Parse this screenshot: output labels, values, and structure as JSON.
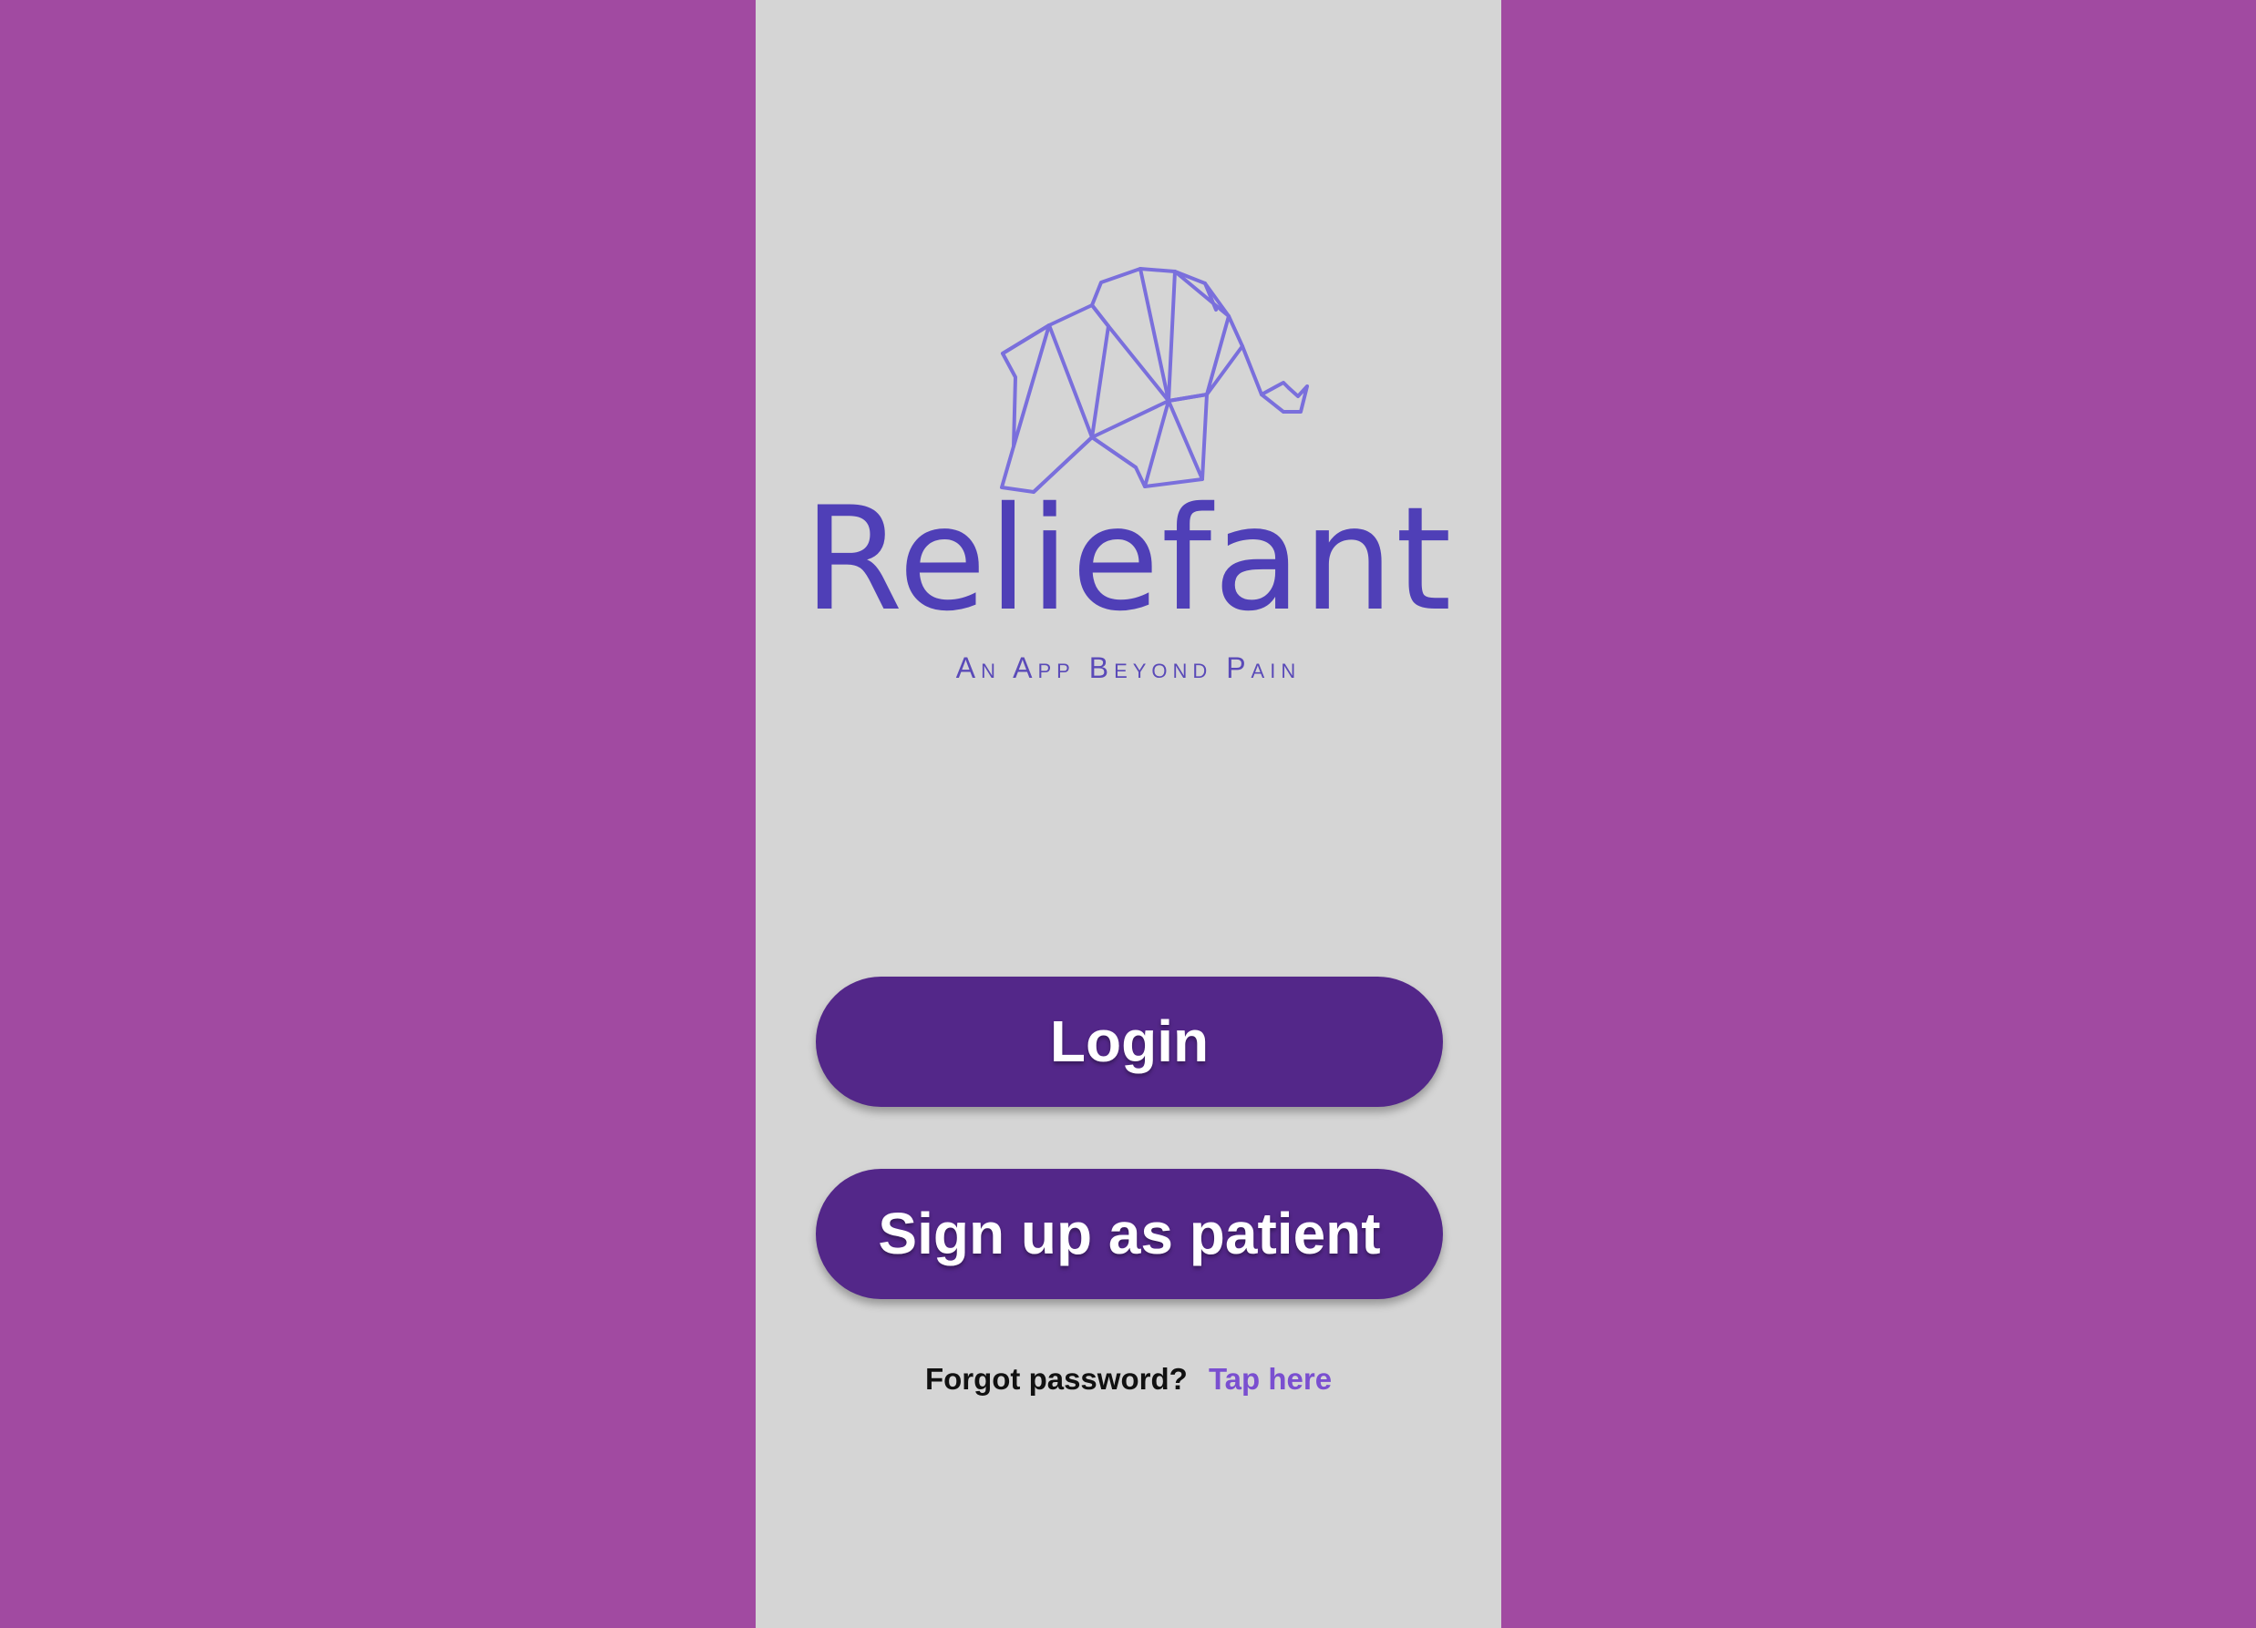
{
  "app": {
    "brand_name": "Reliefant",
    "tagline": "An App Beyond Pain",
    "logo_icon": "origami-elephant-icon"
  },
  "actions": {
    "login_label": "Login",
    "signup_label": "Sign up as patient"
  },
  "forgot": {
    "prompt": "Forgot password?",
    "link_label": "Tap here"
  },
  "colors": {
    "background": "#a14aa1",
    "screen": "#d5d5d5",
    "brand": "#4f3fb7",
    "button": "#532789",
    "button_text": "#ffffff",
    "link": "#7a4fd0"
  }
}
